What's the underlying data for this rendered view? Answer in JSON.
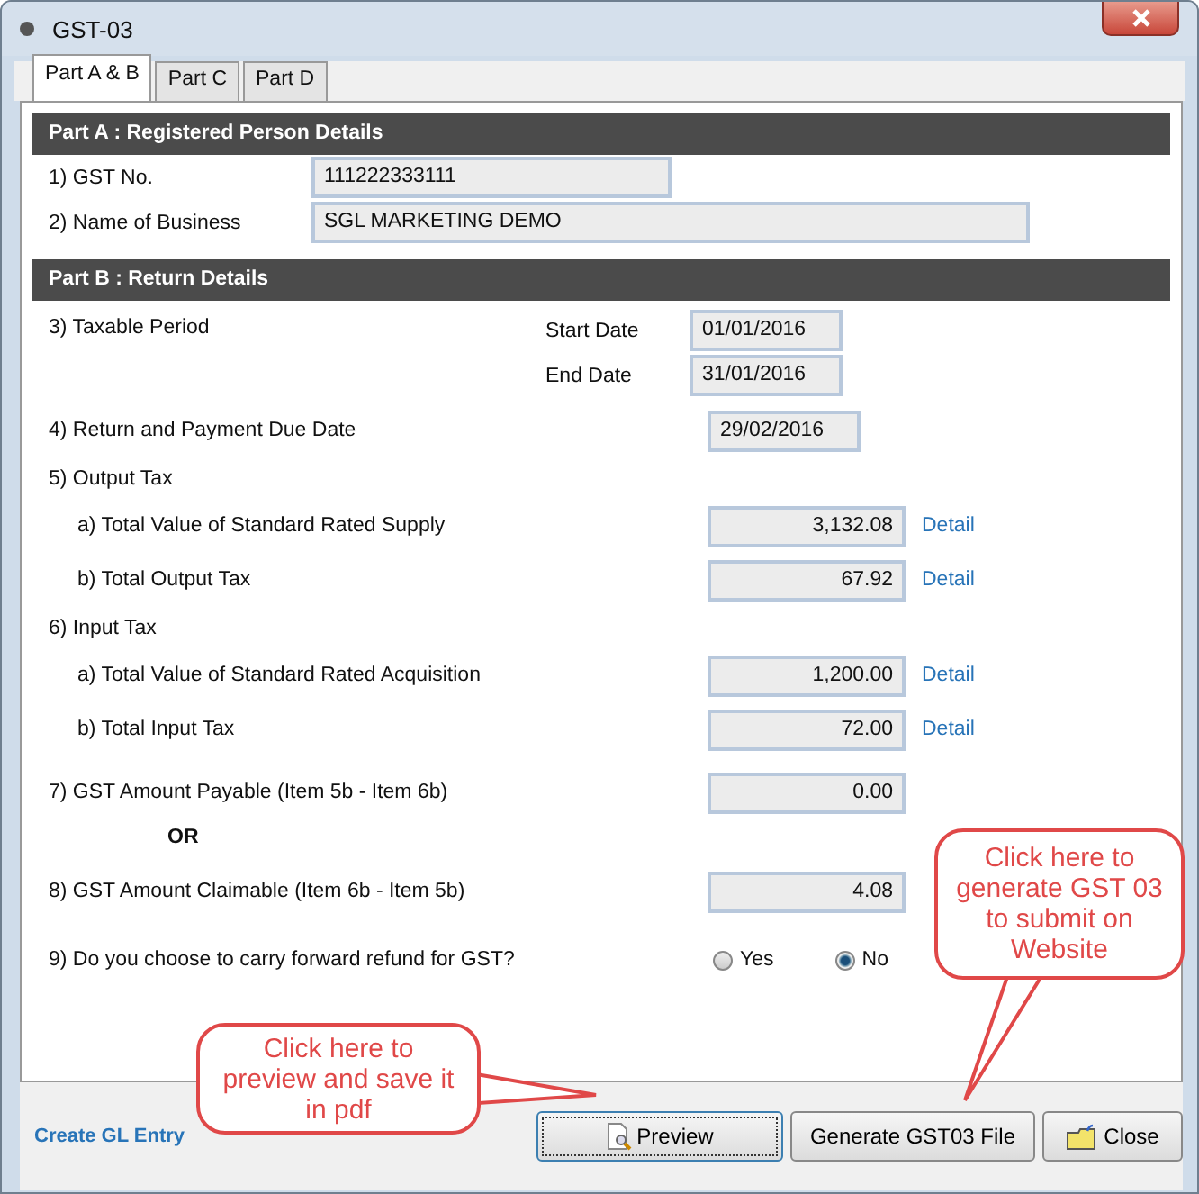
{
  "window": {
    "title": "GST-03"
  },
  "tabs": [
    {
      "label": "Part A & B",
      "selected": true
    },
    {
      "label": "Part C",
      "selected": false
    },
    {
      "label": "Part D",
      "selected": false
    }
  ],
  "part_a": {
    "heading": "Part A : Registered Person Details",
    "rows": [
      {
        "label": "1) GST No.",
        "value": "111222333111"
      },
      {
        "label": "2) Name of Business",
        "value": "SGL MARKETING DEMO"
      }
    ]
  },
  "part_b": {
    "heading": "Part B : Return Details",
    "items": [
      {
        "kind": "period",
        "label": "3) Taxable Period",
        "dates": [
          {
            "label": "Start Date",
            "value": "01/01/2016"
          },
          {
            "label": "End Date",
            "value": "31/01/2016"
          }
        ]
      },
      {
        "kind": "date",
        "label": "4) Return and Payment Due Date",
        "value": "29/02/2016"
      },
      {
        "kind": "group",
        "label": "5) Output Tax",
        "children": [
          {
            "label": "a) Total Value of Standard Rated Supply",
            "value": "3,132.08",
            "link": "Detail"
          },
          {
            "label": "b) Total Output Tax",
            "value": "67.92",
            "link": "Detail"
          }
        ]
      },
      {
        "kind": "group",
        "label": "6) Input Tax",
        "children": [
          {
            "label": "a) Total Value of Standard Rated Acquisition",
            "value": "1,200.00",
            "link": "Detail"
          },
          {
            "label": "b) Total Input Tax",
            "value": "72.00",
            "link": "Detail"
          }
        ]
      },
      {
        "kind": "amount",
        "label": "7) GST Amount Payable (Item 5b - Item 6b)",
        "value": "0.00"
      },
      {
        "kind": "or",
        "label": "OR"
      },
      {
        "kind": "amount",
        "label": "8) GST Amount Claimable (Item 6b - Item 5b)",
        "value": "4.08"
      },
      {
        "kind": "choice",
        "label": "9) Do you choose to carry forward refund for GST?",
        "options": [
          {
            "label": "Yes",
            "selected": false
          },
          {
            "label": "No",
            "selected": true
          }
        ]
      }
    ]
  },
  "footer": {
    "link": "Create GL Entry",
    "buttons": [
      {
        "kind": "preview",
        "label": "Preview",
        "focused": true
      },
      {
        "kind": "generate",
        "label": "Generate GST03 File",
        "focused": false
      },
      {
        "kind": "close",
        "label": "Close",
        "focused": false
      }
    ]
  },
  "callouts": [
    {
      "text": "Click here to preview and save it in pdf"
    },
    {
      "text": "Click here to generate GST 03 to submit on Website"
    }
  ]
}
